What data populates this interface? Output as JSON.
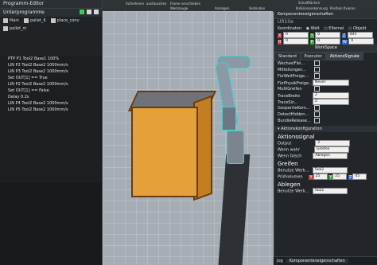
{
  "ribbon": {
    "items": [
      "Aufnehmen",
      "austauschen",
      "Frame verschieben",
      "Werkzeuge",
      "Anzeigen",
      "Verbinden",
      "Kollisionserkennung",
      "Position fixieren"
    ],
    "top_right": "Schaltflächen"
  },
  "editor": {
    "title": "Programm-Editor",
    "section": "Unterprogramme",
    "tabs": [
      "Main",
      "pallet_6",
      "place_conv",
      "pallet_m"
    ],
    "program": [
      "PTP P1 Tool2 Base1 100%",
      "LIN P2 Tool2 Base2 1000mm/s",
      "LIN P3 Tool2 Base2 1000mm/s",
      "Set OUT[1] == True",
      "LIN P2 Tool2 Base2 1000mm/s",
      "Set OUT[1] == False",
      "Delay 0.2s",
      "LIN P4 Tool2 Base2 1000mm/s",
      "LIN P5 Tool2 Base2 1000mm/s"
    ]
  },
  "props": {
    "header": "Komponenteneigenschaften",
    "component": "UR10e",
    "coords_label": "Koordinaten",
    "coord_modes": [
      "Welt",
      "Elternel",
      "Objekt"
    ],
    "x_label": "X",
    "x_val": "0",
    "y_label": "Y",
    "y_val": "0",
    "z_label": "Z",
    "z_val": "845",
    "r_label": "R",
    "r_val": "0",
    "p_label": "P",
    "p_val": "0",
    "w_label": "W",
    "w_val": "0",
    "workspace": "WorkSpace",
    "tabs": [
      "Standard",
      "Executor",
      "AktionsSignale"
    ],
    "signals": [
      {
        "name": "WechselFlei...",
        "value": ""
      },
      {
        "name": "Mitteilungen...",
        "value": ""
      },
      {
        "name": "FürWeitFreige...",
        "value": ""
      },
      {
        "name": "FürPhysikFreige...",
        "value": "Never"
      },
      {
        "name": "MultiGreifen",
        "value": ""
      },
      {
        "name": "TraceBreite",
        "value": "2"
      },
      {
        "name": "TraceSiz...",
        "value": "2"
      },
      {
        "name": "GesperrteKom...",
        "value": ""
      },
      {
        "name": "DetectHidden...",
        "value": ""
      },
      {
        "name": "BundleRelease...",
        "value": ""
      }
    ],
    "aktion_title": "Aktionskonfiguration",
    "aktionssignal": "Aktionssignal",
    "output_label": "Output",
    "output_val": "2",
    "wenn_wahr_label": "Wenn wahr",
    "wenn_wahr_val": "Greifen",
    "wenn_falsch_label": "Wenn falsch",
    "wenn_falsch_val": "Ablegen",
    "greifen": "Greifen",
    "benutze_label": "Benutze Werk...",
    "benutze_val": "Tool2",
    "pruef_label": "Prüfvolumen",
    "pruef_x": "25",
    "pruef_y": "25",
    "pruef_z": "45",
    "ablegen": "Ablegen",
    "ablegen_benutze_label": "Benutze Werk...",
    "ablegen_benutze_val": "Tool2",
    "footer_tabs": [
      "Jog",
      "Komponenteneigenschaften"
    ]
  }
}
